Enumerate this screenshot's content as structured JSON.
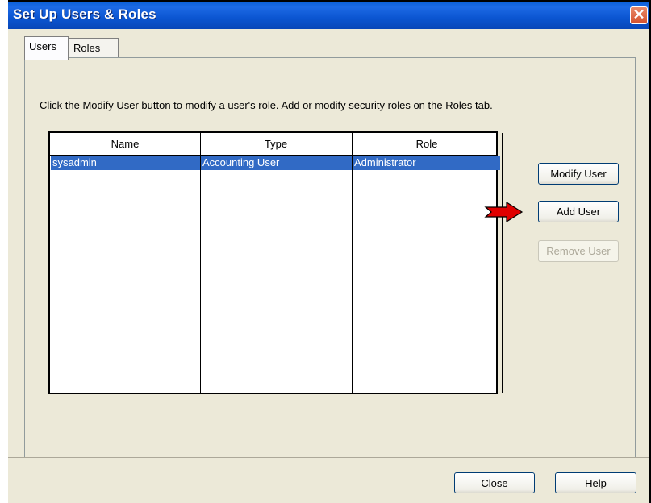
{
  "window": {
    "title": "Set Up Users & Roles",
    "close_glyph": "✕"
  },
  "tabs": [
    {
      "label": "Users",
      "active": true
    },
    {
      "label": "Roles",
      "active": false
    }
  ],
  "instructions": "Click the Modify User button to modify a user's role. Add or modify security roles on the Roles tab.",
  "table": {
    "columns": [
      "Name",
      "Type",
      "Role"
    ],
    "rows": [
      {
        "name": "sysadmin",
        "type": "Accounting User",
        "role": "Administrator",
        "selected": true
      }
    ]
  },
  "side_buttons": {
    "modify_user": "Modify User",
    "add_user": "Add User",
    "remove_user": "Remove User"
  },
  "footer_buttons": {
    "close": "Close",
    "help": "Help"
  },
  "annotation": {
    "arrow_icon": "red-arrow-icon",
    "arrow_color": "#e00000"
  },
  "colors": {
    "titlebar": "#0b55d1",
    "selection": "#316ac5",
    "dialog_bg": "#ece9d8"
  }
}
